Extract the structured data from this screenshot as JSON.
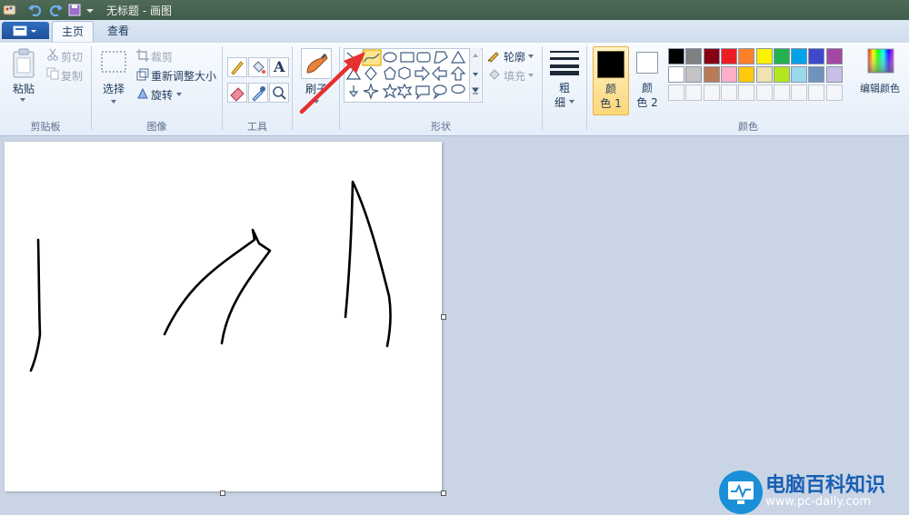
{
  "window": {
    "title": "无标题 - 画图"
  },
  "tabs": [
    {
      "label": "主页"
    },
    {
      "label": "查看"
    }
  ],
  "clipboard": {
    "paste": "粘贴",
    "cut": "剪切",
    "copy": "复制",
    "group": "剪贴板"
  },
  "image": {
    "select": "选择",
    "crop": "裁剪",
    "resize": "重新调整大小",
    "rotate": "旋转",
    "group": "图像"
  },
  "tools": {
    "group": "工具",
    "text_glyph": "A"
  },
  "brushes": {
    "label": "刷子"
  },
  "shapes": {
    "group": "形状",
    "outline": "轮廓",
    "fill": "填充"
  },
  "size": {
    "label_line1": "粗",
    "label_line2": "细"
  },
  "colors": {
    "color1_line1": "颜",
    "color1_line2": "色 1",
    "color2_line1": "颜",
    "color2_line2": "色 2",
    "edit": "编辑颜色",
    "group": "颜色",
    "primary": "#000000",
    "secondary": "#ffffff",
    "palette_row1": [
      "#000000",
      "#7f7f7f",
      "#880015",
      "#ed1c24",
      "#ff7f27",
      "#fff200",
      "#22b14c",
      "#00a2e8",
      "#3f48cc",
      "#a349a4"
    ],
    "palette_row2": [
      "#ffffff",
      "#c3c3c3",
      "#b97a57",
      "#ffaec9",
      "#ffc90e",
      "#efe4b0",
      "#b5e61d",
      "#99d9ea",
      "#7092be",
      "#c8bfe7"
    ]
  },
  "watermark": {
    "title": "电脑百科知识",
    "url": "www.pc-daily.com"
  }
}
